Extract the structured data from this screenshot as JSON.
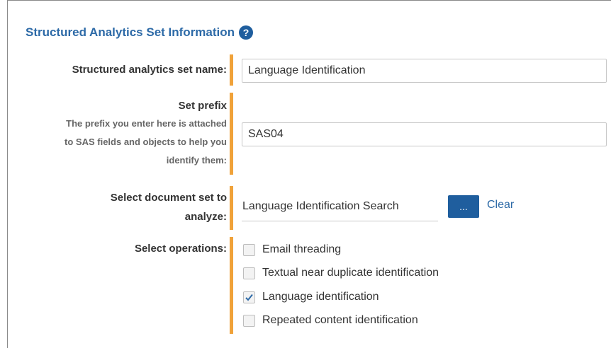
{
  "section": {
    "title": "Structured Analytics Set Information",
    "help_glyph": "?"
  },
  "set_name": {
    "label": "Structured analytics set name:",
    "value": "Language Identification"
  },
  "prefix": {
    "label": "Set prefix",
    "desc_lines": [
      "The prefix you enter here is attached",
      "to SAS fields and objects to help you",
      "identify them:"
    ],
    "value": "SAS04"
  },
  "docset": {
    "label_lines": [
      "Select document set to",
      "analyze:"
    ],
    "value": "Language Identification Search",
    "browse_label": "...",
    "clear_label": "Clear"
  },
  "operations": {
    "label": "Select operations:",
    "items": [
      {
        "label": "Email threading",
        "checked": false
      },
      {
        "label": "Textual near duplicate identification",
        "checked": false
      },
      {
        "label": "Language identification",
        "checked": true
      },
      {
        "label": "Repeated content identification",
        "checked": false
      }
    ]
  },
  "colors": {
    "accent": "#f0a23a",
    "brand": "#1f5e9e",
    "title": "#2d6aa7"
  }
}
